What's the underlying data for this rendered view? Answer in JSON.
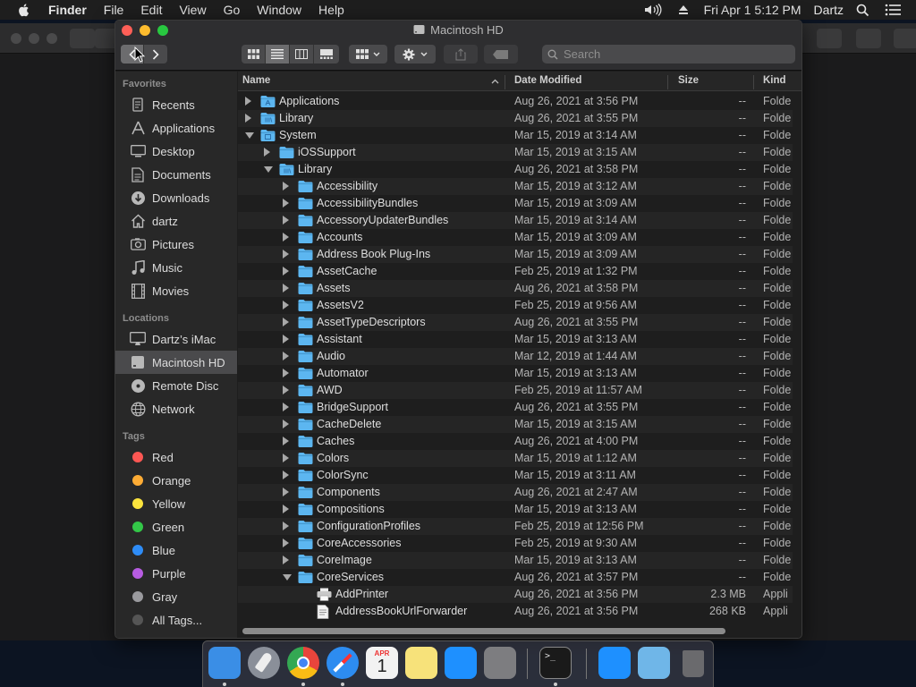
{
  "menubar": {
    "app_name": "Finder",
    "menus": [
      "File",
      "Edit",
      "View",
      "Go",
      "Window",
      "Help"
    ],
    "clock": "Fri Apr 1  5:12 PM",
    "user": "Dartz"
  },
  "window": {
    "title": "Macintosh HD",
    "search_placeholder": "Search"
  },
  "sidebar": {
    "favorites_header": "Favorites",
    "favorites": [
      {
        "label": "Recents",
        "icon": "recents-icon"
      },
      {
        "label": "Applications",
        "icon": "applications-icon"
      },
      {
        "label": "Desktop",
        "icon": "desktop-icon"
      },
      {
        "label": "Documents",
        "icon": "documents-icon"
      },
      {
        "label": "Downloads",
        "icon": "downloads-icon"
      },
      {
        "label": "dartz",
        "icon": "home-icon"
      },
      {
        "label": "Pictures",
        "icon": "pictures-icon"
      },
      {
        "label": "Music",
        "icon": "music-icon"
      },
      {
        "label": "Movies",
        "icon": "movies-icon"
      }
    ],
    "locations_header": "Locations",
    "locations": [
      {
        "label": "Dartz’s iMac",
        "icon": "imac-icon"
      },
      {
        "label": "Macintosh HD",
        "icon": "hard-disk-icon",
        "selected": true
      },
      {
        "label": "Remote Disc",
        "icon": "disc-icon"
      },
      {
        "label": "Network",
        "icon": "network-icon"
      }
    ],
    "tags_header": "Tags",
    "tags": [
      {
        "label": "Red",
        "color": "#fc5753"
      },
      {
        "label": "Orange",
        "color": "#fdac35"
      },
      {
        "label": "Yellow",
        "color": "#fbe33d"
      },
      {
        "label": "Green",
        "color": "#33c748"
      },
      {
        "label": "Blue",
        "color": "#2e8cf6"
      },
      {
        "label": "Purple",
        "color": "#b75ce1"
      },
      {
        "label": "Gray",
        "color": "#9a9a9e"
      },
      {
        "label": "All Tags...",
        "color": "#555555"
      }
    ]
  },
  "columns": {
    "name": "Name",
    "date": "Date Modified",
    "size": "Size",
    "kind": "Kind"
  },
  "rows": [
    {
      "name": "Applications",
      "date": "Aug 26, 2021 at 3:56 PM",
      "size": "--",
      "kind": "Folde",
      "level": 0,
      "state": "closed",
      "icon": "app-folder-icon"
    },
    {
      "name": "Library",
      "date": "Aug 26, 2021 at 3:55 PM",
      "size": "--",
      "kind": "Folde",
      "level": 0,
      "state": "closed",
      "icon": "library-folder-icon"
    },
    {
      "name": "System",
      "date": "Mar 15, 2019 at 3:14 AM",
      "size": "--",
      "kind": "Folde",
      "level": 0,
      "state": "open",
      "icon": "system-folder-icon"
    },
    {
      "name": "iOSSupport",
      "date": "Mar 15, 2019 at 3:15 AM",
      "size": "--",
      "kind": "Folde",
      "level": 1,
      "state": "closed",
      "icon": "folder-icon"
    },
    {
      "name": "Library",
      "date": "Aug 26, 2021 at 3:58 PM",
      "size": "--",
      "kind": "Folde",
      "level": 1,
      "state": "open",
      "icon": "library-folder-icon"
    },
    {
      "name": "Accessibility",
      "date": "Mar 15, 2019 at 3:12 AM",
      "size": "--",
      "kind": "Folde",
      "level": 2,
      "state": "closed",
      "icon": "folder-icon"
    },
    {
      "name": "AccessibilityBundles",
      "date": "Mar 15, 2019 at 3:09 AM",
      "size": "--",
      "kind": "Folde",
      "level": 2,
      "state": "closed",
      "icon": "folder-icon"
    },
    {
      "name": "AccessoryUpdaterBundles",
      "date": "Mar 15, 2019 at 3:14 AM",
      "size": "--",
      "kind": "Folde",
      "level": 2,
      "state": "closed",
      "icon": "folder-icon"
    },
    {
      "name": "Accounts",
      "date": "Mar 15, 2019 at 3:09 AM",
      "size": "--",
      "kind": "Folde",
      "level": 2,
      "state": "closed",
      "icon": "folder-icon"
    },
    {
      "name": "Address Book Plug-Ins",
      "date": "Mar 15, 2019 at 3:09 AM",
      "size": "--",
      "kind": "Folde",
      "level": 2,
      "state": "closed",
      "icon": "folder-icon"
    },
    {
      "name": "AssetCache",
      "date": "Feb 25, 2019 at 1:32 PM",
      "size": "--",
      "kind": "Folde",
      "level": 2,
      "state": "closed",
      "icon": "folder-icon"
    },
    {
      "name": "Assets",
      "date": "Aug 26, 2021 at 3:58 PM",
      "size": "--",
      "kind": "Folde",
      "level": 2,
      "state": "closed",
      "icon": "folder-icon"
    },
    {
      "name": "AssetsV2",
      "date": "Feb 25, 2019 at 9:56 AM",
      "size": "--",
      "kind": "Folde",
      "level": 2,
      "state": "closed",
      "icon": "folder-icon"
    },
    {
      "name": "AssetTypeDescriptors",
      "date": "Aug 26, 2021 at 3:55 PM",
      "size": "--",
      "kind": "Folde",
      "level": 2,
      "state": "closed",
      "icon": "folder-icon"
    },
    {
      "name": "Assistant",
      "date": "Mar 15, 2019 at 3:13 AM",
      "size": "--",
      "kind": "Folde",
      "level": 2,
      "state": "closed",
      "icon": "folder-icon"
    },
    {
      "name": "Audio",
      "date": "Mar 12, 2019 at 1:44 AM",
      "size": "--",
      "kind": "Folde",
      "level": 2,
      "state": "closed",
      "icon": "folder-icon"
    },
    {
      "name": "Automator",
      "date": "Mar 15, 2019 at 3:13 AM",
      "size": "--",
      "kind": "Folde",
      "level": 2,
      "state": "closed",
      "icon": "folder-icon"
    },
    {
      "name": "AWD",
      "date": "Feb 25, 2019 at 11:57 AM",
      "size": "--",
      "kind": "Folde",
      "level": 2,
      "state": "closed",
      "icon": "folder-icon"
    },
    {
      "name": "BridgeSupport",
      "date": "Aug 26, 2021 at 3:55 PM",
      "size": "--",
      "kind": "Folde",
      "level": 2,
      "state": "closed",
      "icon": "folder-icon"
    },
    {
      "name": "CacheDelete",
      "date": "Mar 15, 2019 at 3:15 AM",
      "size": "--",
      "kind": "Folde",
      "level": 2,
      "state": "closed",
      "icon": "folder-icon"
    },
    {
      "name": "Caches",
      "date": "Aug 26, 2021 at 4:00 PM",
      "size": "--",
      "kind": "Folde",
      "level": 2,
      "state": "closed",
      "icon": "folder-icon"
    },
    {
      "name": "Colors",
      "date": "Mar 15, 2019 at 1:12 AM",
      "size": "--",
      "kind": "Folde",
      "level": 2,
      "state": "closed",
      "icon": "folder-icon"
    },
    {
      "name": "ColorSync",
      "date": "Mar 15, 2019 at 3:11 AM",
      "size": "--",
      "kind": "Folde",
      "level": 2,
      "state": "closed",
      "icon": "folder-icon"
    },
    {
      "name": "Components",
      "date": "Aug 26, 2021 at 2:47 AM",
      "size": "--",
      "kind": "Folde",
      "level": 2,
      "state": "closed",
      "icon": "folder-icon"
    },
    {
      "name": "Compositions",
      "date": "Mar 15, 2019 at 3:13 AM",
      "size": "--",
      "kind": "Folde",
      "level": 2,
      "state": "closed",
      "icon": "folder-icon"
    },
    {
      "name": "ConfigurationProfiles",
      "date": "Feb 25, 2019 at 12:56 PM",
      "size": "--",
      "kind": "Folde",
      "level": 2,
      "state": "closed",
      "icon": "folder-icon"
    },
    {
      "name": "CoreAccessories",
      "date": "Feb 25, 2019 at 9:30 AM",
      "size": "--",
      "kind": "Folde",
      "level": 2,
      "state": "closed",
      "icon": "folder-icon"
    },
    {
      "name": "CoreImage",
      "date": "Mar 15, 2019 at 3:13 AM",
      "size": "--",
      "kind": "Folde",
      "level": 2,
      "state": "closed",
      "icon": "folder-icon"
    },
    {
      "name": "CoreServices",
      "date": "Aug 26, 2021 at 3:57 PM",
      "size": "--",
      "kind": "Folde",
      "level": 2,
      "state": "open",
      "icon": "folder-icon"
    },
    {
      "name": "AddPrinter",
      "date": "Aug 26, 2021 at 3:56 PM",
      "size": "2.3 MB",
      "kind": "Appli",
      "level": 3,
      "state": "none",
      "icon": "printer-app-icon"
    },
    {
      "name": "AddressBookUrlForwarder",
      "date": "Aug 26, 2021 at 3:56 PM",
      "size": "268 KB",
      "kind": "Appli",
      "level": 3,
      "state": "none",
      "icon": "address-book-app-icon"
    }
  ],
  "dock": {
    "apps": [
      {
        "name": "finder-icon",
        "color": "#3a8ee6",
        "running": true
      },
      {
        "name": "launchpad-icon",
        "color": "#8a8f99",
        "running": false
      },
      {
        "name": "chrome-icon",
        "color": "#e8453c",
        "running": true
      },
      {
        "name": "safari-icon",
        "color": "#2d8cf0",
        "running": true
      },
      {
        "name": "calendar-icon",
        "color": "#f2f2f2",
        "running": false
      },
      {
        "name": "notes-icon",
        "color": "#f7e27a",
        "running": false
      },
      {
        "name": "app-store-icon",
        "color": "#1e90ff",
        "running": false
      },
      {
        "name": "system-preferences-icon",
        "color": "#7d7d80",
        "running": false
      },
      {
        "name": "terminal-icon",
        "color": "#1a1a1a",
        "running": true
      },
      {
        "name": "app-store-folder-icon",
        "color": "#1e90ff",
        "running": false
      },
      {
        "name": "downloads-folder-icon",
        "color": "#6fb6e8",
        "running": false
      },
      {
        "name": "trash-icon",
        "color": "#555558",
        "running": false
      }
    ],
    "calendar_month": "APR",
    "calendar_day": "1"
  }
}
